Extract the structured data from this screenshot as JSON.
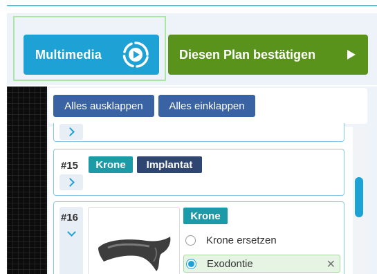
{
  "header": {
    "multimedia_label": "Multimedia",
    "confirm_label": "Diesen Plan bestätigen"
  },
  "toolbar": {
    "expand_all": "Alles ausklappen",
    "collapse_all": "Alles einklappen"
  },
  "cards": [
    {
      "tooth": "#15",
      "tags": [
        "Krone",
        "Implantat"
      ]
    },
    {
      "tooth": "#16",
      "tag": "Krone",
      "options": [
        {
          "label": "Krone ersetzen",
          "selected": false
        },
        {
          "label": "Exodontie",
          "selected": true,
          "remove": "✕"
        }
      ]
    }
  ],
  "icons": {
    "multimedia": "multimedia-play-icon",
    "confirm": "play-icon",
    "expand": "chevron-right-icon",
    "collapse": "chevron-down-icon"
  },
  "colors": {
    "accent_blue": "#1ea2d6",
    "confirm_green": "#5a931b",
    "toolbar_button": "#3a63a4",
    "tag_teal": "#1d9aa8",
    "tag_navy": "#2f4672"
  }
}
